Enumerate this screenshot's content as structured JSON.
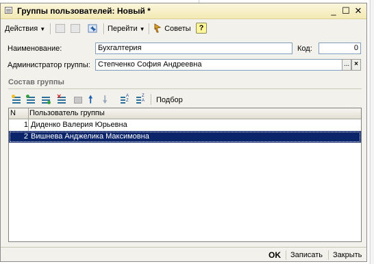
{
  "window": {
    "title": "Группы пользователей: Новый *",
    "controls": {
      "minimize": "_",
      "maximize": "☐",
      "close": "✕"
    }
  },
  "toolbar": {
    "actions_label": "Действия",
    "goto_label": "Перейти",
    "tips_label": "Советы",
    "help_label": "?"
  },
  "form": {
    "name_label": "Наименование:",
    "name_value": "Бухгалтерия",
    "code_label": "Код:",
    "code_value": "0",
    "admin_label": "Администратор группы:",
    "admin_value": "Степченко София Андреевна",
    "select_button": "...",
    "clear_button": "×"
  },
  "members": {
    "section_title": "Состав группы",
    "pick_label": "Подбор",
    "columns": [
      "N",
      "Пользователь группы"
    ],
    "rows": [
      {
        "n": "1",
        "user": "Диденко Валерия Юрьевна"
      },
      {
        "n": "2",
        "user": "Вишнева Анджелика Максимовна"
      }
    ]
  },
  "footer": {
    "ok_label": "OK",
    "save_label": "Записать",
    "close_label": "Закрыть"
  },
  "colors": {
    "title_bar": "#f3e9b4",
    "selection": "#0a246a"
  }
}
